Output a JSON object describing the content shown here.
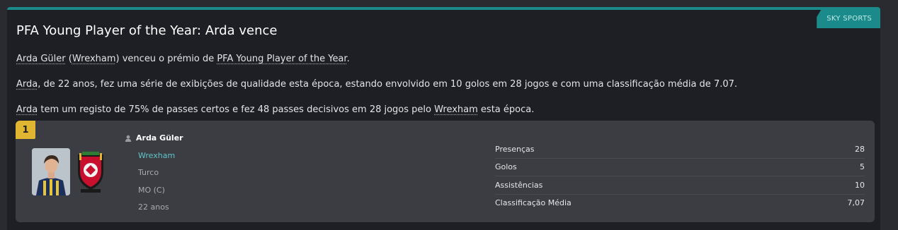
{
  "source": "SKY SPORTS",
  "title": "PFA Young Player of the Year: Arda vence",
  "paragraph1": {
    "player": "Arda Güler",
    "open_paren": " (",
    "club": "Wrexham",
    "mid": ") venceu o prémio de ",
    "award": "PFA Young Player of the Year",
    "end": "."
  },
  "paragraph2": {
    "player": "Arda",
    "text": ", de 22 anos, fez uma série de exibições de qualidade esta época, estando envolvido em 10 golos em 28 jogos e com uma classificação média de 7.07."
  },
  "paragraph3": {
    "player": "Arda",
    "text": " tem um registo de 75% de passes certos e fez 48 passes decisivos em 28 jogos pelo ",
    "club": "Wrexham",
    "end": " esta época."
  },
  "card": {
    "rank": "1",
    "player_name": "Arda Güler",
    "club": "Wrexham",
    "nationality": "Turco",
    "position": "MO (C)",
    "age": "22 anos",
    "stats": [
      {
        "label": "Presenças",
        "value": "28"
      },
      {
        "label": "Golos",
        "value": "5"
      },
      {
        "label": "Assistências",
        "value": "10"
      },
      {
        "label": "Classificação Média",
        "value": "7,07"
      }
    ]
  },
  "colors": {
    "accent": "#1b8a8a",
    "rank_badge": "#e0b531",
    "link": "#5fc6cc"
  }
}
